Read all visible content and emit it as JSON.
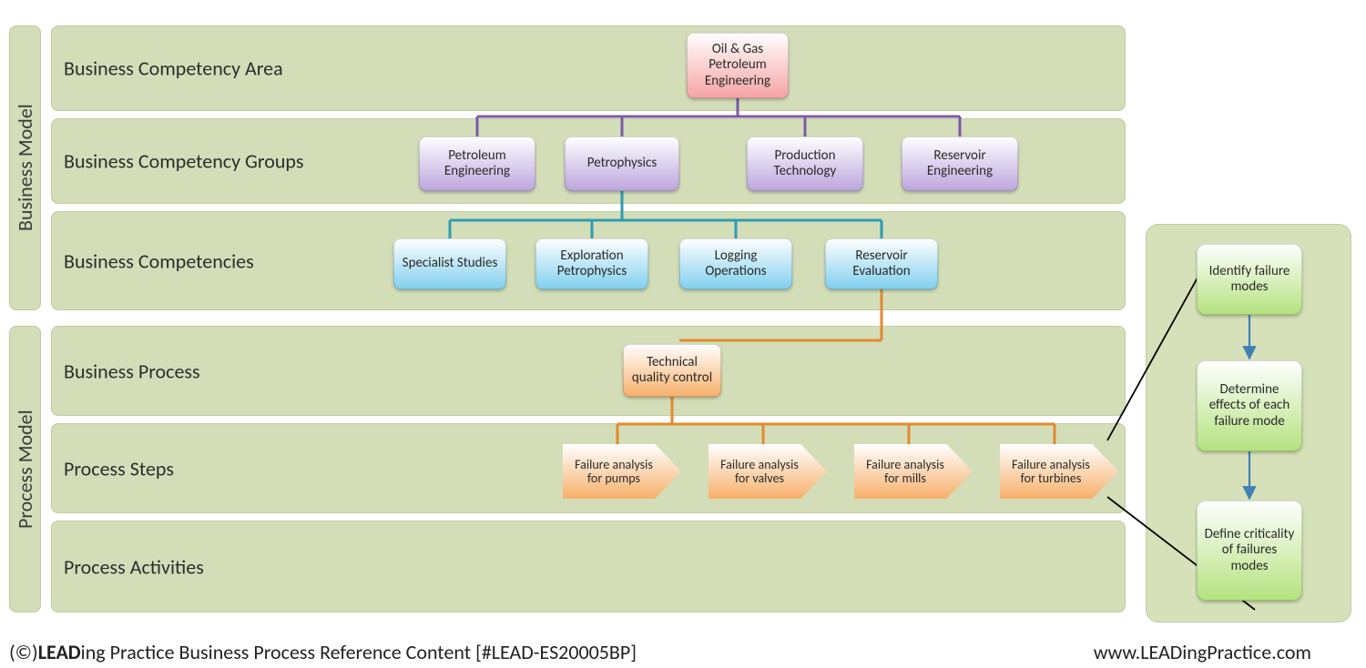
{
  "side": {
    "business_model": "Business Model",
    "process_model": "Process Model"
  },
  "rows": {
    "area": "Business Competency Area",
    "groups": "Business Competency Groups",
    "competencies": "Business Competencies",
    "process": "Business Process",
    "steps": "Process Steps",
    "activities": "Process Activities"
  },
  "area_box": "Oil & Gas Petroleum Engineering",
  "groups_boxes": [
    "Petroleum Engineering",
    "Petrophysics",
    "Production Technology",
    "Reservoir Engineering"
  ],
  "competencies_boxes": [
    "Specialist Studies",
    "Exploration Petrophysics",
    "Logging Operations",
    "Reservoir Evaluation"
  ],
  "process_box": "Technical quality control",
  "steps_boxes": [
    "Failure analysis for pumps",
    "Failure analysis for valves",
    "Failure analysis for mills",
    "Failure analysis for turbines"
  ],
  "activities_boxes": [
    "Identify failure modes",
    "Determine effects of each failure mode",
    "Define criticality of failures modes"
  ],
  "footer": {
    "copyright_symbol": "(©)",
    "brand_bold": "LEAD",
    "brand_rest": "ing Practice Business Process Reference Content [#LEAD-ES20005BP]",
    "url": "www.LEADingPractice.com"
  }
}
